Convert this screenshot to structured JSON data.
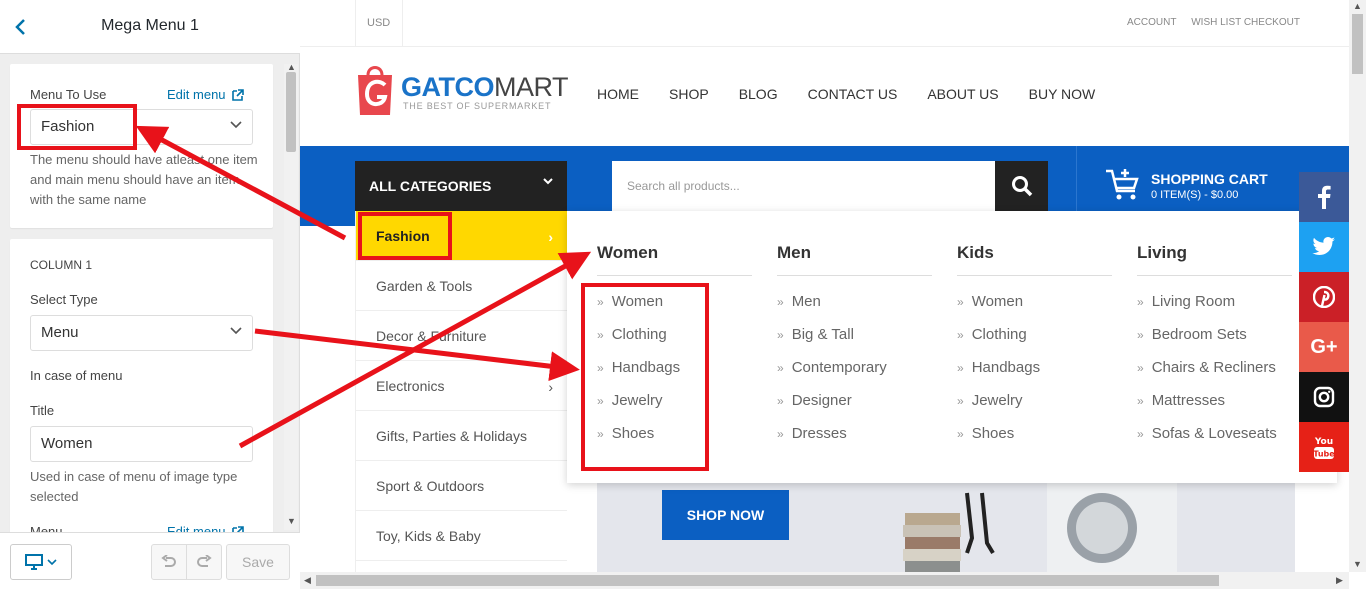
{
  "customizer": {
    "title": "Mega Menu 1",
    "menu_to_use_label": "Menu To Use",
    "edit_menu_label": "Edit menu",
    "menu_select_value": "Fashion",
    "menu_help": "The menu should have atleast one item and main menu should have an item with the same name",
    "column_heading": "COLUMN 1",
    "select_type_label": "Select Type",
    "select_type_value": "Menu",
    "in_case_label": "In case of menu",
    "title_label": "Title",
    "title_value": "Women",
    "image_help": "Used in case of menu of image type selected",
    "menu_label_2": "Menu",
    "edit_menu_label_2": "Edit menu",
    "save_label": "Save"
  },
  "store": {
    "currency": "USD",
    "top_links": [
      "ACCOUNT",
      "WISH LIST CHECKOUT"
    ],
    "logo_part1": "GATCO",
    "logo_part2": "MART",
    "logo_tagline": "THE BEST OF SUPERMARKET",
    "nav": [
      "HOME",
      "SHOP",
      "BLOG",
      "CONTACT US",
      "ABOUT US",
      "BUY NOW"
    ],
    "all_categories": "ALL CATEGORIES",
    "search_placeholder": "Search all products...",
    "cart_title": "SHOPPING CART",
    "cart_sub": "0 ITEM(S) - $0.00",
    "categories": [
      "Fashion",
      "Garden & Tools",
      "Decor & Furniture",
      "Electronics",
      "Gifts, Parties & Holidays",
      "Sport & Outdoors",
      "Toy, Kids & Baby"
    ],
    "shop_now": "SHOP NOW",
    "mega_menu": [
      {
        "title": "Women",
        "items": [
          "Women",
          "Clothing",
          "Handbags",
          "Jewelry",
          "Shoes"
        ]
      },
      {
        "title": "Men",
        "items": [
          "Men",
          "Big & Tall",
          "Contemporary",
          "Designer",
          "Dresses"
        ]
      },
      {
        "title": "Kids",
        "items": [
          "Women",
          "Clothing",
          "Handbags",
          "Jewelry",
          "Shoes"
        ]
      },
      {
        "title": "Living",
        "items": [
          "Living Room",
          "Bedroom Sets",
          "Chairs & Recliners",
          "Mattresses",
          "Sofas & Loveseats"
        ]
      }
    ],
    "social": [
      {
        "name": "facebook-icon",
        "color": "#3b5998",
        "glyph": "f"
      },
      {
        "name": "twitter-icon",
        "color": "#1da1f2",
        "glyph": "t"
      },
      {
        "name": "pinterest-icon",
        "color": "#cb2027",
        "glyph": "P"
      },
      {
        "name": "google-plus-icon",
        "color": "#e95a4a",
        "glyph": "G+"
      },
      {
        "name": "instagram-icon",
        "color": "#111111",
        "glyph": "ig"
      },
      {
        "name": "youtube-icon",
        "color": "#e62117",
        "glyph": "You"
      }
    ]
  },
  "colors": {
    "brand_blue": "#0b5fc2",
    "highlight_yellow": "#ffd800",
    "annotation_red": "#e8121a",
    "wp_link": "#0073aa"
  }
}
